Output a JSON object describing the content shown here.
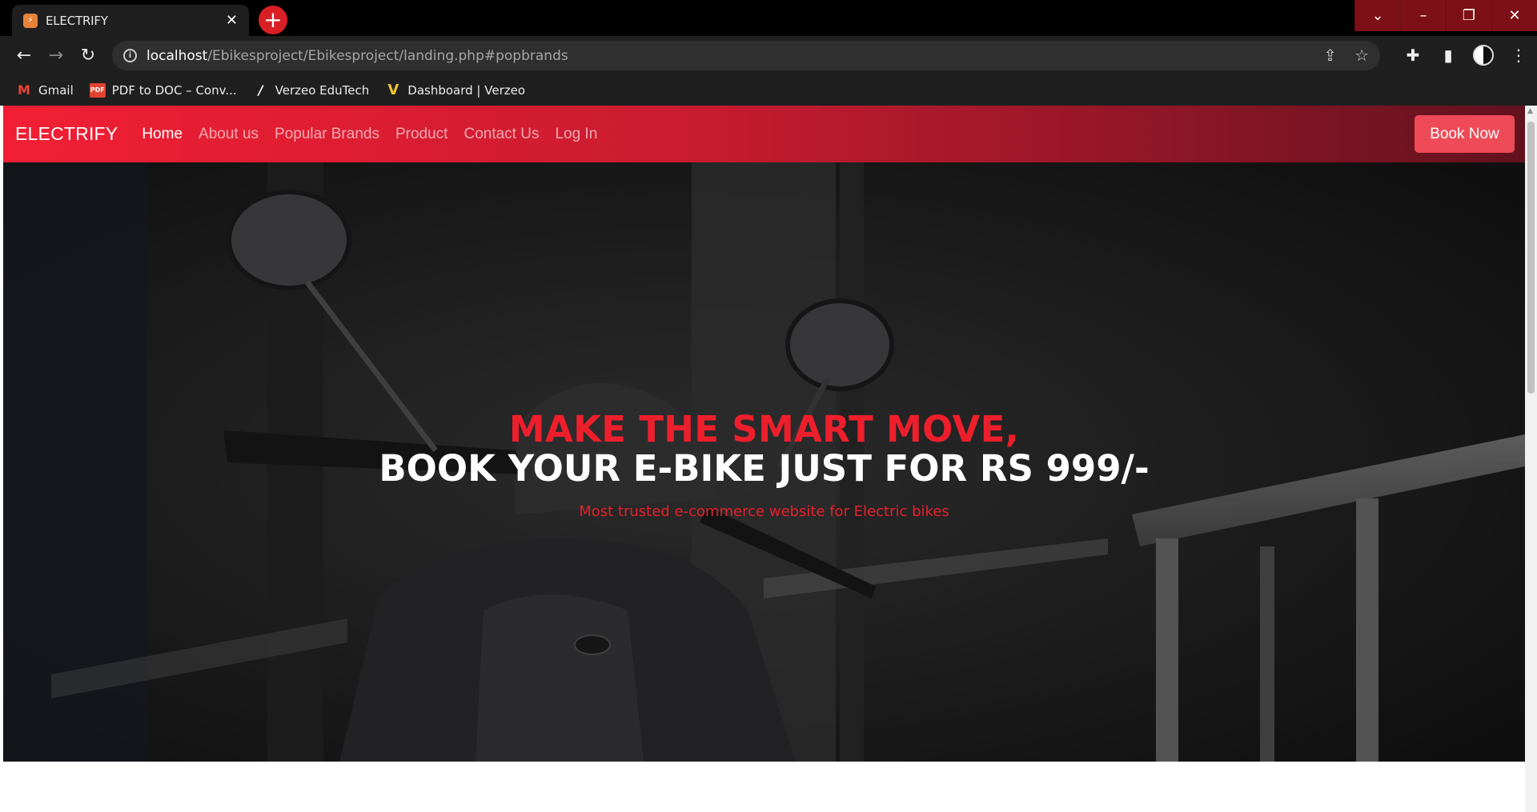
{
  "browser": {
    "tab_title": "ELECTRIFY",
    "tab_favicon_text": "⚡",
    "url_host": "localhost",
    "url_path": "/Ebikesproject/Ebikesproject/landing.php#popbrands",
    "bookmarks": [
      {
        "label": "Gmail",
        "icon": "gmail-icon"
      },
      {
        "label": "PDF to DOC – Conv...",
        "icon": "pdf-icon"
      },
      {
        "label": "Verzeo EduTech",
        "icon": "verzeo-icon"
      },
      {
        "label": "Dashboard | Verzeo",
        "icon": "dashboard-icon"
      }
    ]
  },
  "site": {
    "brand": "ELECTRIFY",
    "nav": {
      "home": "Home",
      "about": "About us",
      "brands": "Popular Brands",
      "product": "Product",
      "contact": "Contact Us",
      "login": "Log In"
    },
    "book_now": "Book Now",
    "accent_color": "#ee1f2c"
  },
  "hero": {
    "headline_red": "MAKE THE SMART MOVE,",
    "headline_white": "BOOK YOUR E-BIKE JUST FOR RS 999/-",
    "tagline": "Most trusted e-commerce website for Electric bikes"
  }
}
